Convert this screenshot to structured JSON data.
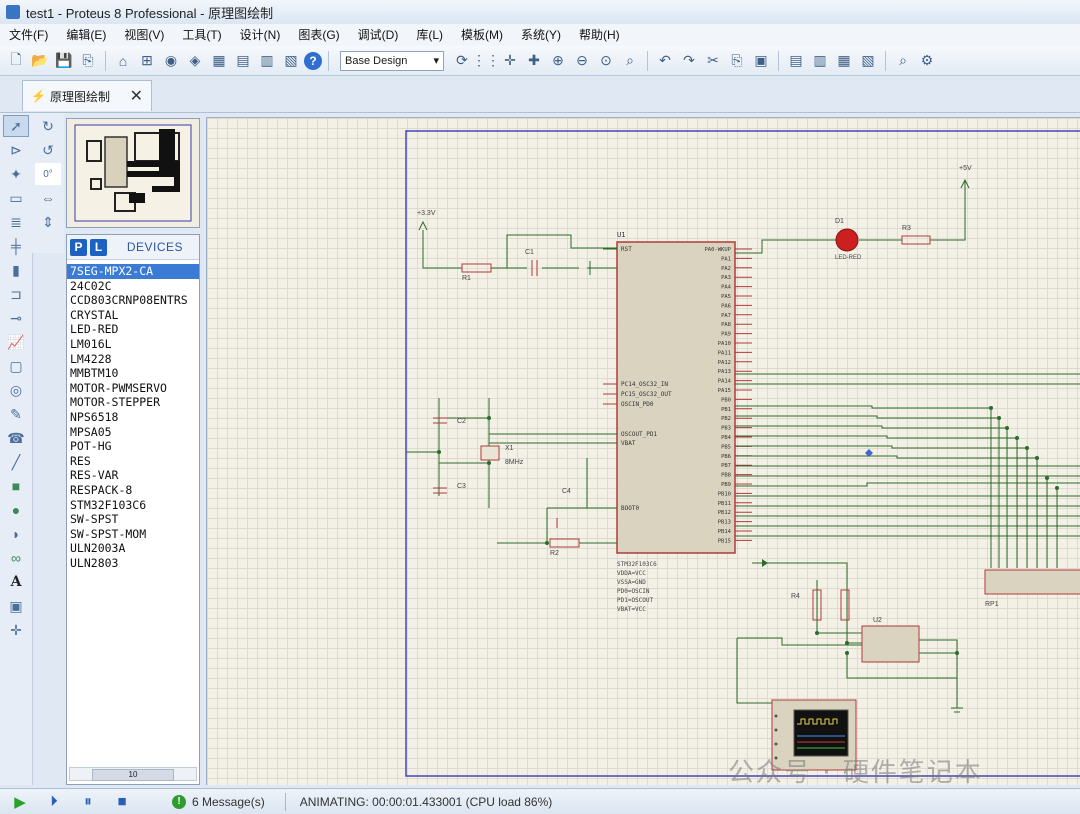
{
  "window": {
    "title": "test1 - Proteus 8 Professional - 原理图绘制"
  },
  "menu": [
    "文件(F)",
    "编辑(E)",
    "视图(V)",
    "工具(T)",
    "设计(N)",
    "图表(G)",
    "调试(D)",
    "库(L)",
    "模板(M)",
    "系统(Y)",
    "帮助(H)"
  ],
  "toolbar": {
    "variant_select": "Base Design"
  },
  "tab": {
    "label": "原理图绘制",
    "close": "✕"
  },
  "devices": {
    "pick_label": "P",
    "lib_label": "L",
    "header": "DEVICES",
    "items": [
      "7SEG-MPX2-CA",
      "24C02C",
      "CCD803CRNP08ENTRS",
      "CRYSTAL",
      "LED-RED",
      "LM016L",
      "LM4228",
      "MMBTM10",
      "MOTOR-PWMSERVO",
      "MOTOR-STEPPER",
      "NPS6518",
      "MPSA05",
      "POT-HG",
      "RES",
      "RES-VAR",
      "RESPACK-8",
      "STM32F103C6",
      "SW-SPST",
      "SW-SPST-MOM",
      "ULN2003A",
      "ULN2803"
    ],
    "selected_index": 0,
    "scroll_label": "10"
  },
  "schematic": {
    "mcu_ref": "U1",
    "mcu_pins_left": [
      "RST",
      "PC14_OSC32_IN",
      "PC15_OSC32_OUT",
      "OSCIN_PD0",
      "OSCOUT_PD1",
      "VBAT",
      "BOOT0"
    ],
    "mcu_pins_right": [
      "PA0-WKUP",
      "PA1",
      "PA2",
      "PA3",
      "PA4",
      "PA5",
      "PA6",
      "PA7",
      "PA8",
      "PA9",
      "PA10",
      "PA11",
      "PA12",
      "PA13",
      "PA14",
      "PA15",
      "PB0",
      "PB1",
      "PB2",
      "PB3",
      "PB4",
      "PB5",
      "PB6",
      "PB7",
      "PB8",
      "PB9",
      "PB10",
      "PB11",
      "PB12",
      "PB13",
      "PB14",
      "PB15"
    ],
    "mcu_below": [
      "STM32F103C6",
      "VDDA=VCC",
      "VSSA=GND",
      "PD0=OSCIN",
      "PD1=OSCOUT",
      "VBAT=VCC"
    ],
    "labels": {
      "c1": "C1",
      "c2": "C2",
      "c3": "C3",
      "c4": "C4",
      "x1": "X1",
      "x1_val": "8MHz",
      "d1": "D1",
      "d1_val": "LED-RED",
      "r1": "R1",
      "r2": "R2",
      "r3": "R3",
      "r4": "R4",
      "u2": "U2",
      "rp1": "RP1",
      "vcc": "+3.3V",
      "vcc2": "+5V"
    }
  },
  "status": {
    "play": "▶",
    "step": "⏵",
    "pause": "⏸",
    "stop": "■",
    "messages": "6 Message(s)",
    "animating": "ANIMATING: 00:00:01.433001 (CPU load 86%)"
  },
  "watermark": "公众号 · 硬件笔记本",
  "colors": {
    "wire": "#2b6b2b",
    "component": "#b23a3a",
    "canvas": "#f3f0e6",
    "selection": "#3a7bd5",
    "border": "#3f3fb0"
  }
}
